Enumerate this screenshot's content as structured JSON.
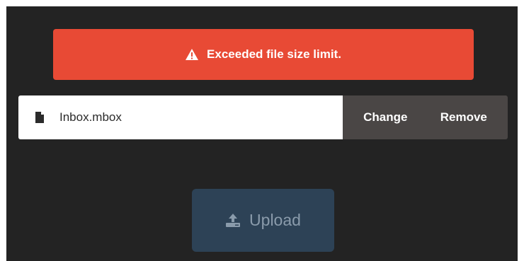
{
  "alert": {
    "icon": "warning-triangle-icon",
    "message": "Exceeded file size limit.",
    "color": "#e84a35"
  },
  "file": {
    "icon": "file-icon",
    "name": "Inbox.mbox"
  },
  "actions": {
    "change_label": "Change",
    "remove_label": "Remove"
  },
  "upload": {
    "icon": "upload-icon",
    "label": "Upload",
    "disabled": true,
    "color": "#2d4256"
  },
  "colors": {
    "background": "#232323",
    "action_bar": "#4a4645"
  }
}
